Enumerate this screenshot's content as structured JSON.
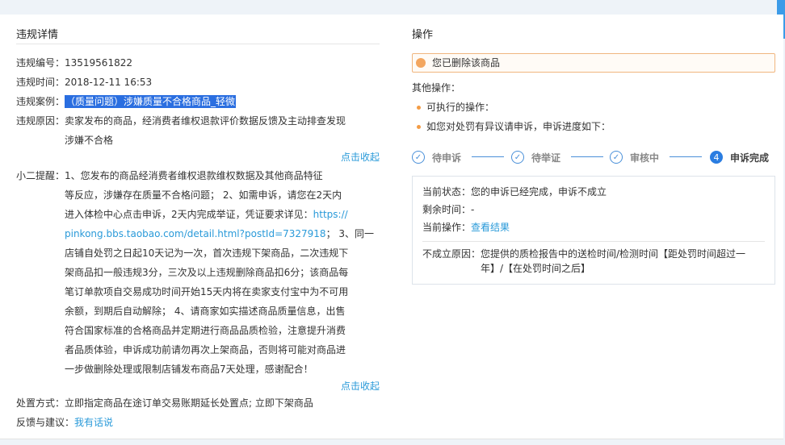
{
  "violation": {
    "title": "违规详情",
    "number_label": "违规编号：",
    "number_value": "13519561822",
    "time_label": "违规时间：",
    "time_value": "2018-12-11 16:53",
    "case_label": "违规案例：",
    "case_value": "（质量问题）涉嫌质量不合格商品_轻微",
    "reason_label": "违规原因：",
    "reason_line1": "卖家发布的商品，经消费者维权退款评价数据反馈及主动排查发现",
    "reason_line2": "涉嫌不合格",
    "collapse1": "点击收起",
    "tip_label": "小二提醒：",
    "tip_lines": [
      "1、您发布的商品经消费者维权退款维权数据及其他商品特征",
      "等反应，涉嫌存在质量不合格问题； 2、如需申诉，请您在2天内",
      "进入体检中心点击申诉，2天内完成举证，凭证要求详见：",
      "https://",
      "pinkong.bbs.taobao.com/detail.html?postId=7327918",
      "； 3、同一",
      "店铺自处罚之日起10天记为一次，首次违规下架商品，二次违规下",
      "架商品扣一般违规3分，三次及以上违规删除商品扣6分；该商品每",
      "笔订单款项自交易成功时间开始15天内将在卖家支付宝中为不可用",
      "余额，到期后自动解除； 4、请商家如实描述商品质量信息，出售",
      "符合国家标准的合格商品并定期进行商品品质检验，注意提升消费",
      "者品质体验，申诉成功前请勿再次上架商品，否则将可能对商品进",
      "一步做删除处理或限制店铺发布商品7天处理，感谢配合！"
    ],
    "collapse2": "点击收起",
    "handle_label": "处置方式：",
    "handle_value": "立即指定商品在途订单交易账期延长处置点; 立即下架商品",
    "feedback_label": "反馈与建议：",
    "feedback_link": "我有话说"
  },
  "operation": {
    "title": "操作",
    "notice": "您已删除该商品",
    "other_label": "其他操作：",
    "bullet1": "可执行的操作：",
    "bullet2": "如您对处罚有异议请申诉，申诉进度如下：",
    "steps": [
      {
        "label": "待申诉",
        "mark": "✓"
      },
      {
        "label": "待举证",
        "mark": "✓"
      },
      {
        "label": "审核中",
        "mark": "✓"
      },
      {
        "label": "申诉完成",
        "mark": "4"
      }
    ],
    "status_label": "当前状态：",
    "status_value": "您的申诉已经完成，申诉不成立",
    "remain_label": "剩余时间：",
    "remain_value": "-",
    "action_label": "当前操作：",
    "action_link": "查看结果",
    "fail_label": "不成立原因：",
    "fail_line1": "您提供的质检报告中的送检时间/检测时间【距处罚时间超过一",
    "fail_line2": "年】/【在处罚时间之后】"
  },
  "colors": {
    "accent": "#2a9ad9",
    "highlight": "#2a6ee0",
    "notice_border": "#f0b67f",
    "bullet": "#f39c45",
    "step": "#4a90d9"
  }
}
